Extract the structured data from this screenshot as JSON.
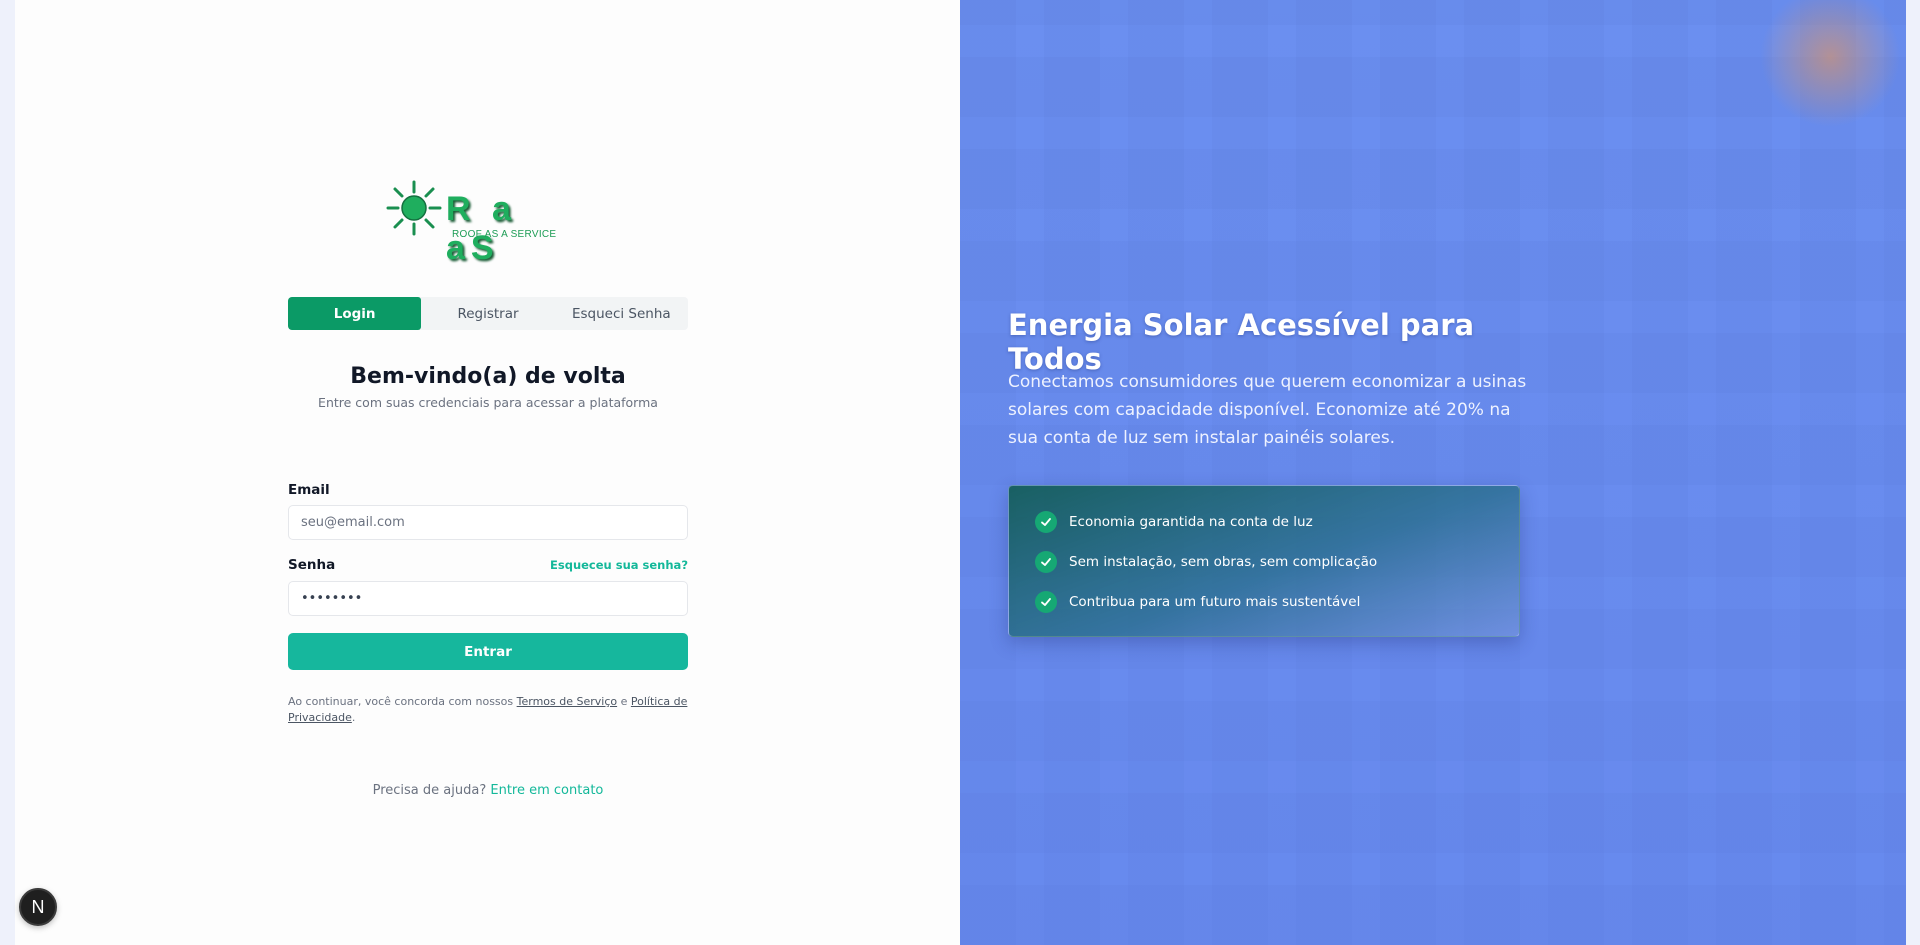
{
  "logo": {
    "word": "R a aS",
    "subtitle": "ROOF AS A SERVICE"
  },
  "tabs": [
    {
      "label": "Login",
      "active": true
    },
    {
      "label": "Registrar",
      "active": false
    },
    {
      "label": "Esqueci Senha",
      "active": false
    }
  ],
  "welcome": {
    "title": "Bem-vindo(a) de volta",
    "subtitle": "Entre com suas credenciais para acessar a plataforma"
  },
  "form": {
    "email_label": "Email",
    "email_placeholder": "seu@email.com",
    "password_label": "Senha",
    "forgot_link": "Esqueceu sua senha?",
    "password_value": "••••••••",
    "submit_label": "Entrar"
  },
  "terms": {
    "prefix": "Ao continuar, você concorda com nossos",
    "terms_link": "Termos de Serviço",
    "conjunction": "e",
    "privacy_link": "Política de Privacidade",
    "suffix": "."
  },
  "help": {
    "question": "Precisa de ajuda?",
    "link": "Entre em contato"
  },
  "badge": {
    "letter": "N"
  },
  "hero": {
    "title": "Energia Solar Acessível para Todos",
    "text": "Conectamos consumidores que querem economizar a usinas solares com capacidade disponível. Economize até 20% na sua conta de luz sem instalar painéis solares.",
    "benefits": [
      "Economia garantida na conta de luz",
      "Sem instalação, sem obras, sem complicação",
      "Contribua para um futuro mais sustentável"
    ]
  },
  "colors": {
    "brand_green": "#0b9a66",
    "accent_teal": "#16b79d",
    "hero_blue": "#6b8ff0"
  },
  "icons": {
    "logo": "sun-icon",
    "check": "check-icon"
  }
}
